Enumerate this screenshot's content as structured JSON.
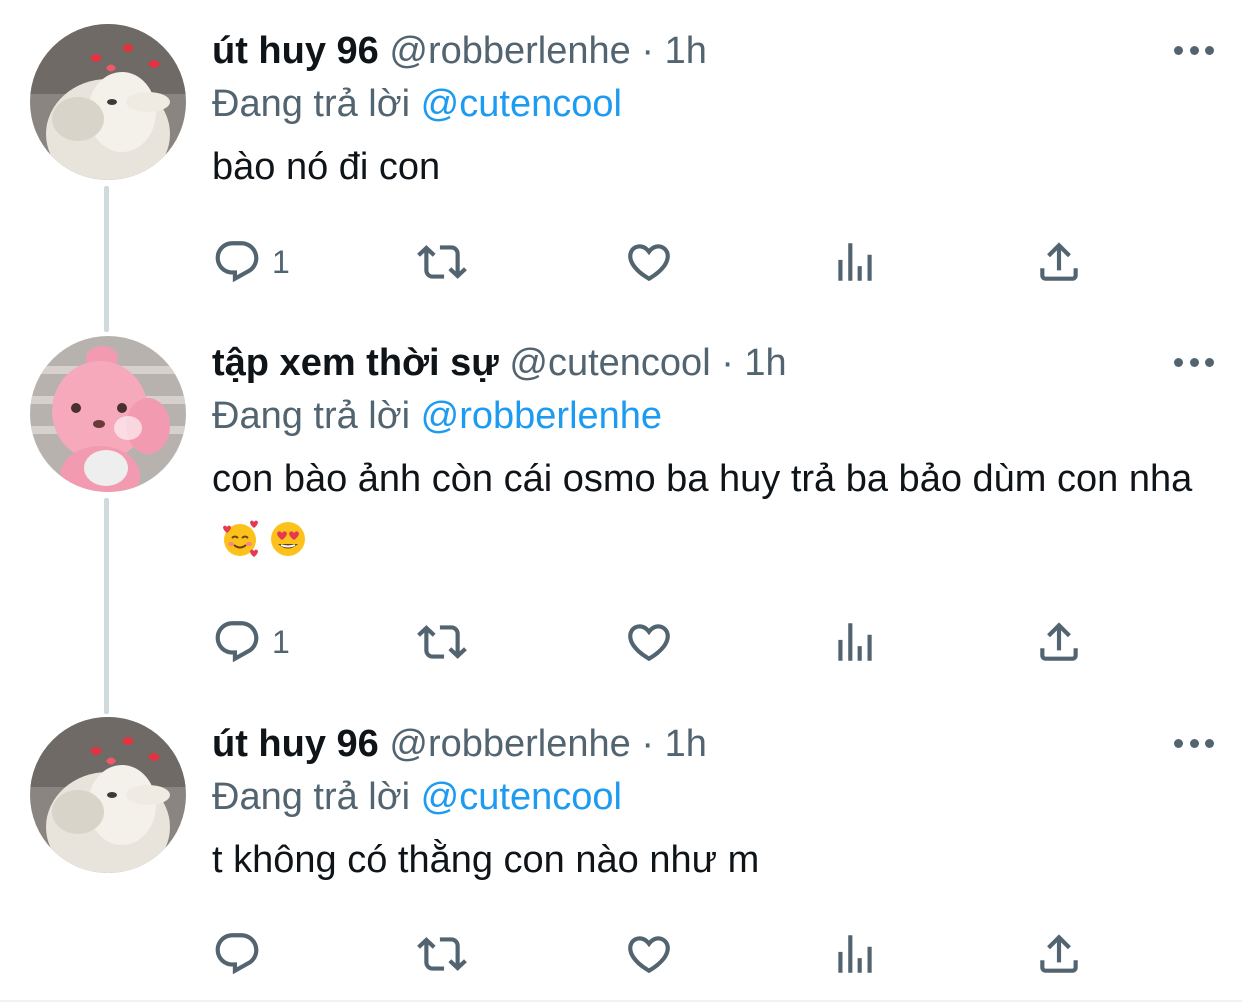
{
  "tweets": [
    {
      "display_name": "út huy 96",
      "handle": "@robberlenhe",
      "separator": "·",
      "time": "1h",
      "replying_prefix": "Đang trả lời",
      "replying_to": "@cutencool",
      "text": "bào nó đi con",
      "reply_count": "1",
      "avatar": "goat-avatar"
    },
    {
      "display_name": "tập xem thời sự",
      "handle": "@cutencool",
      "separator": "·",
      "time": "1h",
      "replying_prefix": "Đang trả lời",
      "replying_to": "@robberlenhe",
      "text": "con bào ảnh còn cái osmo ba huy trả ba bảo dùm con nha",
      "emojis": [
        "smiling-face-with-hearts",
        "heart-eyes"
      ],
      "reply_count": "1",
      "avatar": "pink-bear-avatar"
    },
    {
      "display_name": "út huy 96",
      "handle": "@robberlenhe",
      "separator": "·",
      "time": "1h",
      "replying_prefix": "Đang trả lời",
      "replying_to": "@cutencool",
      "text": "t không có thằng con nào như m",
      "reply_count": "",
      "avatar": "goat-avatar"
    }
  ],
  "icons": {
    "reply": "reply-icon",
    "retweet": "retweet-icon",
    "like": "heart-icon",
    "analytics": "analytics-icon",
    "share": "share-icon",
    "more": "more-icon"
  },
  "colors": {
    "text": "#0f1419",
    "secondary": "#536471",
    "link": "#1d9bf0",
    "thread_line": "#cfd9de"
  }
}
